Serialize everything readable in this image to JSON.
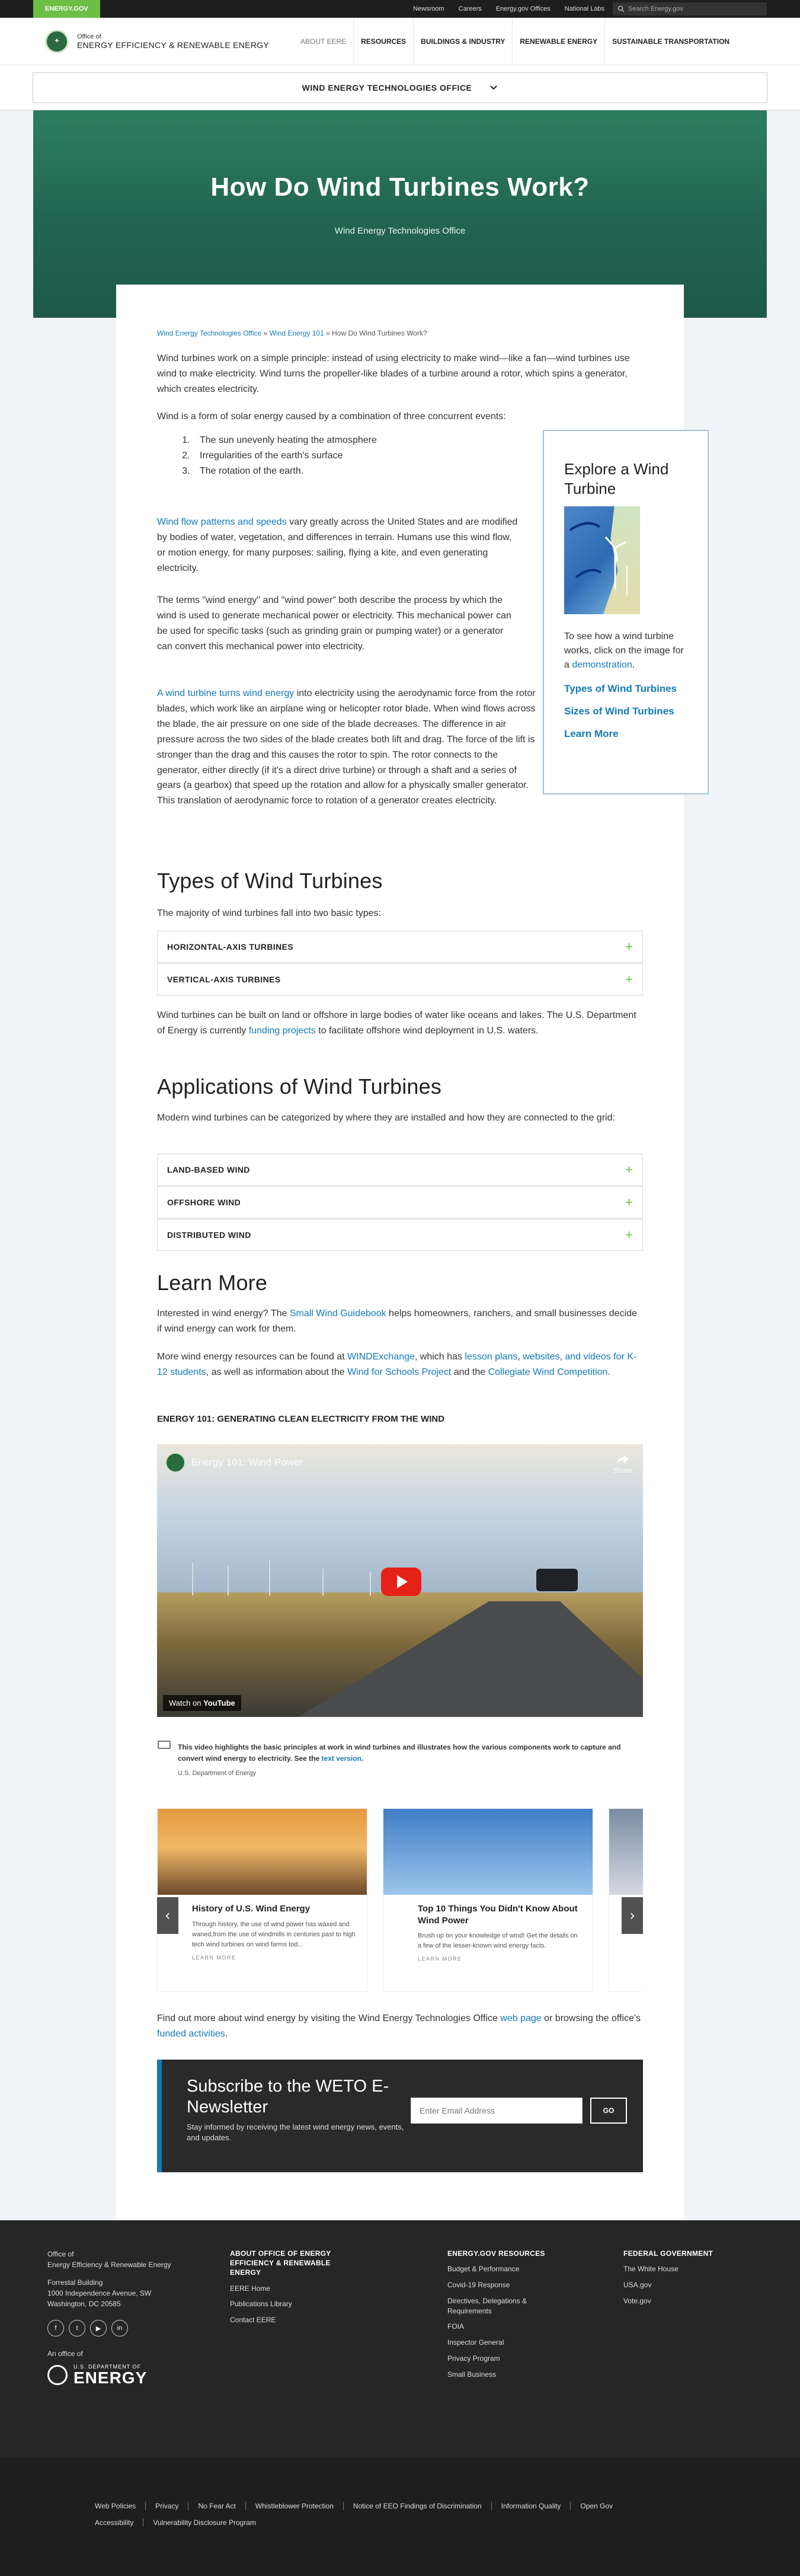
{
  "topbar": {
    "brand": "ENERGY.GOV",
    "links": [
      "Newsroom",
      "Careers",
      "Energy.gov Offices",
      "National Labs"
    ],
    "search_placeholder": "Search Energy.gov"
  },
  "header": {
    "office_small": "Office of",
    "office_name": "ENERGY EFFICIENCY & RENEWABLE ENERGY",
    "nav": [
      "ABOUT EERE",
      "RESOURCES",
      "BUILDINGS & INDUSTRY",
      "RENEWABLE ENERGY",
      "SUSTAINABLE TRANSPORTATION"
    ]
  },
  "subnav": {
    "title": "WIND ENERGY TECHNOLOGIES OFFICE"
  },
  "hero": {
    "title": "How Do Wind Turbines Work?",
    "subtitle": "Wind Energy Technologies Office"
  },
  "breadcrumb": {
    "a": "Wind Energy Technologies Office",
    "sep": "»",
    "b": "Wind Energy 101",
    "c": "How Do Wind Turbines Work?"
  },
  "intro": {
    "p1": "Wind turbines work on a simple principle: instead of using electricity to make wind—like a fan—wind turbines use wind to make electricity. Wind turns the propeller-like blades of a turbine around a rotor, which spins a generator, which creates electricity.",
    "p2": "Wind is a form of solar energy caused by a combination of three concurrent events:",
    "list": [
      "The sun unevenly heating the atmosphere",
      "Irregularities of the earth's surface",
      "The rotation of the earth."
    ],
    "p3_link": "Wind flow patterns and speeds",
    "p3_rest": " vary greatly across the United States and are modified by bodies of water, vegetation, and differences in terrain. Humans use this wind flow, or motion energy, for many purposes: sailing, flying a kite, and even generating electricity.",
    "p4": "The terms \"wind energy\" and \"wind power\" both describe the process by which the wind is used to generate mechanical power or electricity. This mechanical power can be used for specific tasks (such as grinding grain or pumping water) or a generator can convert this mechanical power into electricity.",
    "p5_link": "A wind turbine turns wind energy",
    "p5_rest": " into electricity using the aerodynamic force from the rotor blades, which work like an airplane wing or helicopter rotor blade. When wind flows across the blade, the air pressure on one side of the blade decreases. The difference in air pressure across the two sides of the blade creates both lift and drag. The force of the lift is stronger than the drag and this causes the rotor to spin. The rotor connects to the generator, either directly (if it's a direct drive turbine) or through a shaft and a series of gears (a gearbox) that speed up the rotation and allow for a physically smaller generator. This translation of aerodynamic force to rotation of a generator creates electricity."
  },
  "sidebar": {
    "title": "Explore a Wind Turbine",
    "text": "To see how a wind turbine works, click on the image for a ",
    "text_link": "demonstration",
    "links": [
      "Types of Wind Turbines",
      "Sizes of Wind Turbines",
      "Learn More"
    ]
  },
  "types": {
    "heading": "Types of Wind Turbines",
    "intro": "The majority of wind turbines fall into two basic types:",
    "accordions": [
      "HORIZONTAL-AXIS TURBINES",
      "VERTICAL-AXIS TURBINES"
    ],
    "after_a": "Wind turbines can be built on land or offshore in large bodies of water like oceans and lakes. The U.S. Department of Energy is currently ",
    "after_link": "funding projects",
    "after_b": " to facilitate offshore wind deployment in U.S. waters."
  },
  "applications": {
    "heading": "Applications of Wind Turbines",
    "intro": "Modern wind turbines can be categorized by where they are installed and how they are connected to the grid:",
    "accordions": [
      "LAND-BASED WIND",
      "OFFSHORE WIND",
      "DISTRIBUTED WIND"
    ]
  },
  "learn": {
    "heading": "Learn More",
    "p1_a": "Interested in wind energy? The ",
    "p1_link": "Small Wind Guidebook",
    "p1_b": " helps homeowners, ranchers, and small businesses decide if wind energy can work for them.",
    "p2_a": "More wind energy resources can be found at ",
    "p2_l1": "WINDExchange",
    "p2_b": ", which has ",
    "p2_l2": "lesson plans",
    "p2_c": ", ",
    "p2_l3": "websites",
    "p2_d": ", ",
    "p2_l4": "and videos for K-12 students",
    "p2_e": ", as well as information about the ",
    "p2_l5": "Wind for Schools Project",
    "p2_f": " and the ",
    "p2_l6": "Collegiate Wind Competition",
    "p2_g": ".",
    "video_heading": "ENERGY 101: GENERATING CLEAN ELECTRICITY FROM THE WIND"
  },
  "video": {
    "title": "Energy 101: Wind Power",
    "share": "Share",
    "watch_on": "Watch on",
    "youtube": "YouTube",
    "caption_a": "This video highlights the basic principles at work in wind turbines and illustrates how the various components work to capture and convert wind energy to electricity. See the ",
    "caption_link": "text version",
    "caption_b": ".",
    "credit": "U.S. Department of Energy"
  },
  "carousel": [
    {
      "title": "History of U.S. Wind Energy",
      "desc": "Through history, the use of wind power has waxed and waned,from the use of windmills in centuries past to high tech wind turbines on wind farms tod...",
      "more": "LEARN MORE"
    },
    {
      "title": "Top 10 Things You Didn't Know About Wind Power",
      "desc": "Brush up on your knowledge of wind! Get the details on a few of the lesser-known wind energy facts.",
      "more": "LEARN MORE"
    }
  ],
  "outro": {
    "a": "Find out more about wind energy by visiting the Wind Energy Technologies Office ",
    "l1": "web page",
    "b": " or browsing the office's ",
    "l2": "funded activities",
    "c": "."
  },
  "subscribe": {
    "title": "Subscribe to the WETO E-Newsletter",
    "text": "Stay informed by receiving the latest wind energy news, events, and updates.",
    "placeholder": "Enter Email Address",
    "button": "GO"
  },
  "footer": {
    "col1": {
      "line1": "Office of",
      "line2": "Energy Efficiency & Renewable Energy",
      "addr1": "Forrestal Building",
      "addr2": "1000 Independence Avenue, SW",
      "addr3": "Washington, DC 20585",
      "social": [
        "f",
        "t",
        "▶",
        "in"
      ],
      "an_office": "An office of",
      "doe_small": "U.S. DEPARTMENT OF",
      "doe_big": "ENERGY"
    },
    "col2": {
      "heading": "ABOUT OFFICE OF ENERGY EFFICIENCY & RENEWABLE ENERGY",
      "links": [
        "EERE Home",
        "Publications Library",
        "Contact EERE"
      ]
    },
    "col3": {
      "heading": "ENERGY.GOV RESOURCES",
      "links": [
        "Budget & Performance",
        "Covid-19 Response",
        "Directives, Delegations & Requirements",
        "FOIA",
        "Inspector General",
        "Privacy Program",
        "Small Business"
      ]
    },
    "col4": {
      "heading": "FEDERAL GOVERNMENT",
      "links": [
        "The White House",
        "USA.gov",
        "Vote.gov"
      ]
    },
    "bottom_links": [
      "Web Policies",
      "Privacy",
      "No Fear Act",
      "Whistleblower Protection",
      "Notice of EEO Findings of Discrimination",
      "Information Quality",
      "Open Gov",
      "Accessibility",
      "Vulnerability Disclosure Program"
    ]
  },
  "colors": {
    "brand_green": "#6cbe45",
    "link_blue": "#1479b8",
    "hero_green": "#216450",
    "dark": "#262626"
  }
}
